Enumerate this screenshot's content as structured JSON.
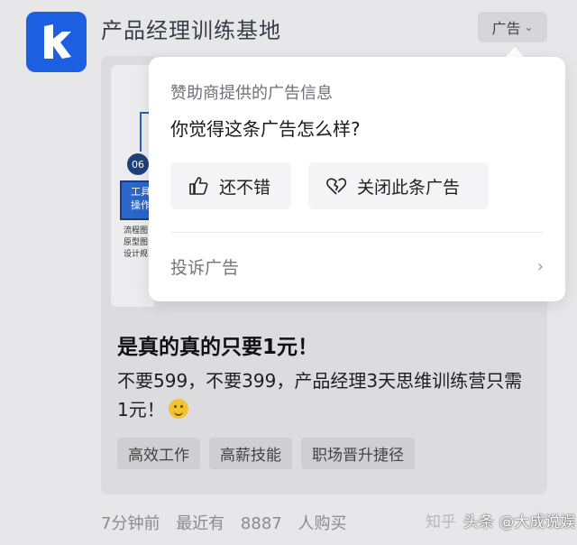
{
  "account": {
    "name": "产品经理训练基地",
    "logo_icon": "k-logo-icon",
    "brand_color": "#1c5fe0"
  },
  "ad_label": "广告",
  "card": {
    "thumbnail": {
      "step_number": "06",
      "box_lines": [
        "工具",
        "操作"
      ],
      "small_lines": [
        "流程图",
        "原型图",
        "设计规"
      ]
    },
    "headline": "是真的真的只要1元！",
    "body": "不要599，不要399，产品经理3天思维训练营只需1元！",
    "tags": [
      "高效工作",
      "高薪技能",
      "职场晋升捷径"
    ]
  },
  "footer": {
    "time": "7分钟前",
    "buyers": "最近有 8887 人购买"
  },
  "watermark": {
    "left": "知乎",
    "right": "@嫩瓜研究僧",
    "overlay": "头条 @大成说娱"
  },
  "popup": {
    "subtitle": "赞助商提供的广告信息",
    "question": "你觉得这条广告怎么样?",
    "like_label": "还不错",
    "close_label": "关闭此条广告",
    "report_label": "投诉广告"
  }
}
